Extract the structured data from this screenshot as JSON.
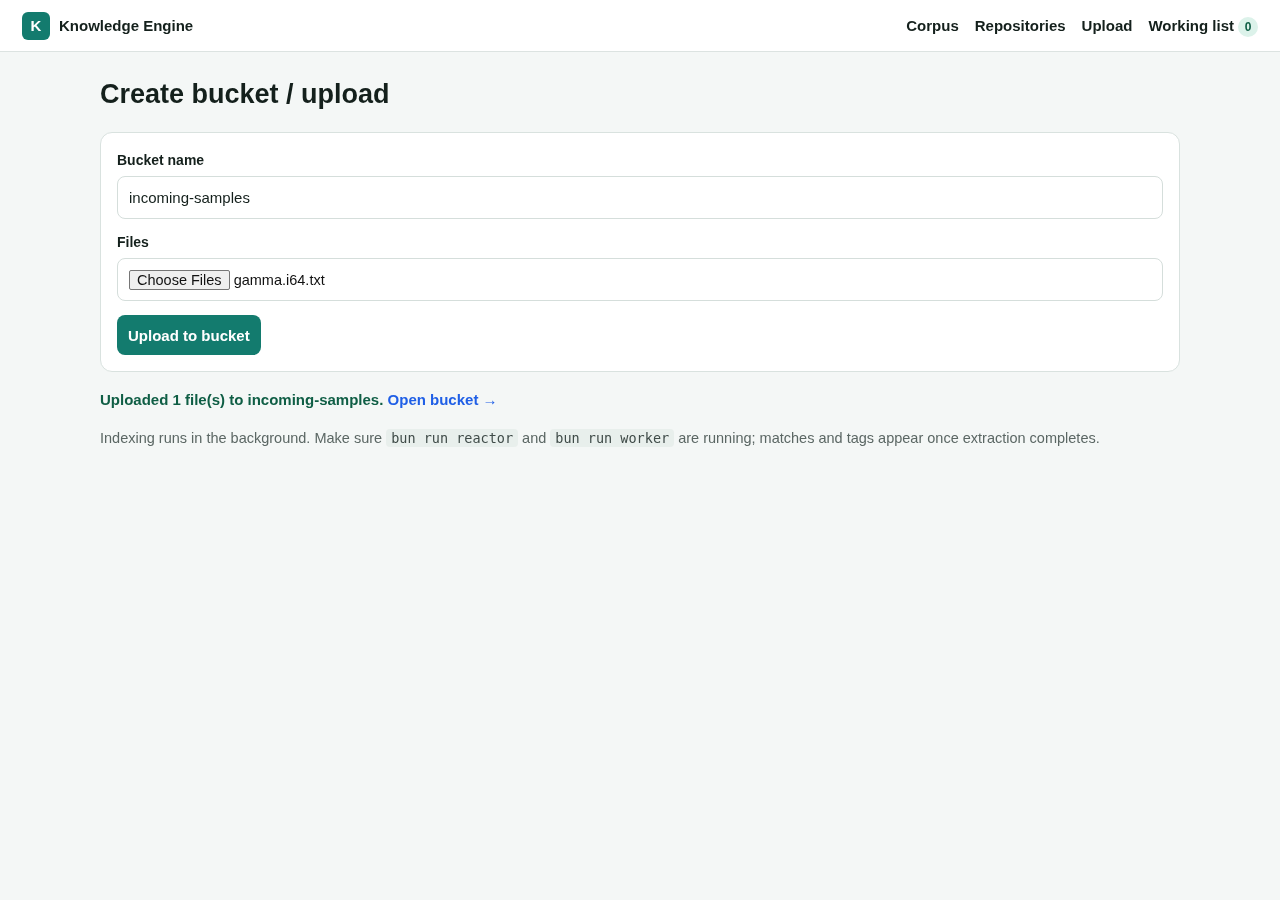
{
  "header": {
    "logo_letter": "K",
    "brand": "Knowledge Engine",
    "nav": [
      {
        "label": "Corpus"
      },
      {
        "label": "Repositories"
      },
      {
        "label": "Upload"
      },
      {
        "label": "Working list",
        "count": "0"
      }
    ]
  },
  "page_title": "Create bucket / upload",
  "form": {
    "fields": [
      {
        "kind": "text",
        "label": "Bucket name",
        "value": "incoming-samples"
      },
      {
        "kind": "file",
        "label": "Files",
        "button": "Choose Files",
        "value": "gamma.i64.txt"
      }
    ],
    "submit": "Upload to bucket"
  },
  "result": {
    "message": "Uploaded 1 file(s) to incoming-samples.",
    "link": "Open bucket →"
  },
  "note": [
    {
      "kind": "text",
      "text": "Indexing runs in the background. Make sure"
    },
    {
      "kind": "code",
      "text": "bun run reactor"
    },
    {
      "kind": "text",
      "text": "and"
    },
    {
      "kind": "code",
      "text": "bun run worker"
    },
    {
      "kind": "text",
      "text": "are running; matches and tags appear once extraction completes."
    }
  ]
}
